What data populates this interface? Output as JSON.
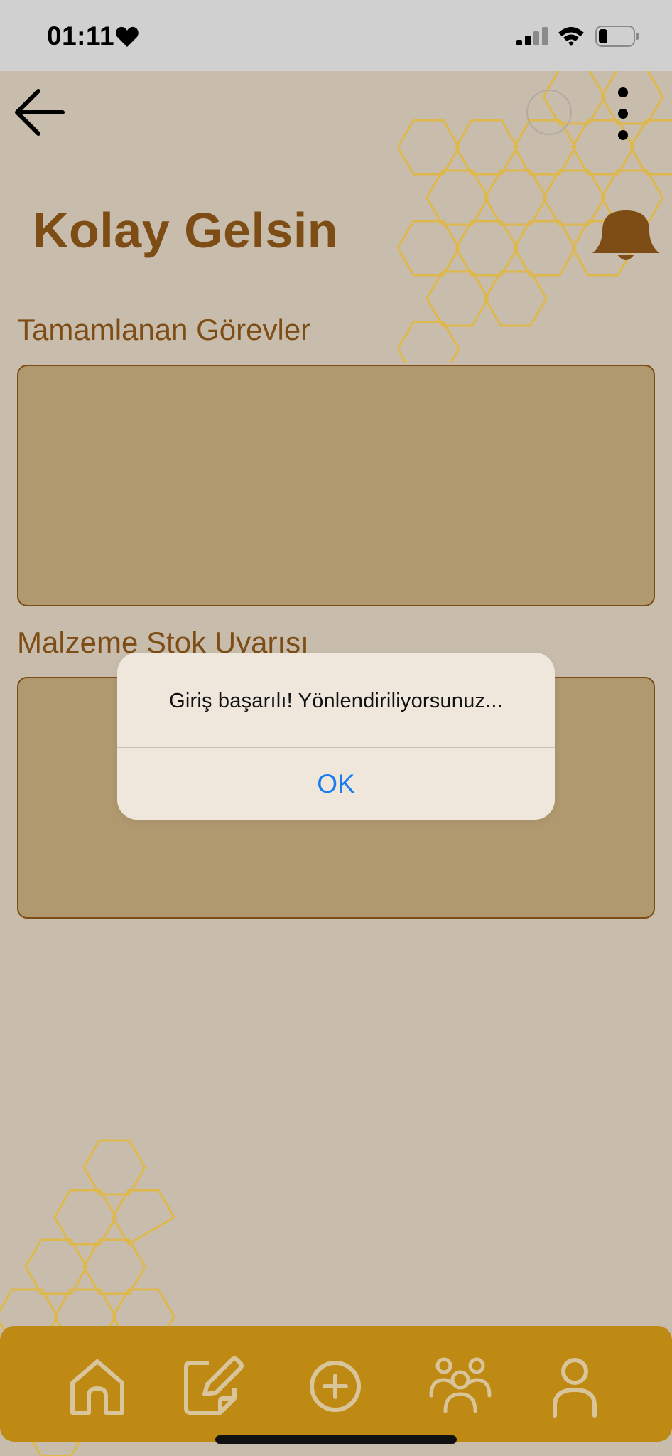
{
  "status_bar": {
    "time": "01:11",
    "icons": [
      "heart-icon",
      "cellular-signal-icon",
      "wifi-icon",
      "battery-icon"
    ]
  },
  "header": {
    "title": "Kolay Gelsin",
    "icons": [
      "back-arrow-icon",
      "avatar-circle",
      "more-vertical-icon",
      "bell-icon"
    ]
  },
  "sections": {
    "completed_tasks": "Tamamlanan Görevler",
    "stock_alert": "Malzeme Stok Uyarısı"
  },
  "alert": {
    "message": "Giriş başarılı! Yönlendiriliyorsunuz...",
    "ok_label": "OK"
  },
  "bottom_nav": {
    "items": [
      "home-icon",
      "edit-note-icon",
      "add-circle-icon",
      "group-icon",
      "profile-icon"
    ]
  },
  "colors": {
    "background": "#c8bdac",
    "title_brown": "#7e4d15",
    "card_fill": "#b0986f",
    "nav_bar": "#bf8a14",
    "honeycomb": "#e2b83a",
    "alert_bg": "#efe7db",
    "ok_blue": "#1b7cf0"
  }
}
